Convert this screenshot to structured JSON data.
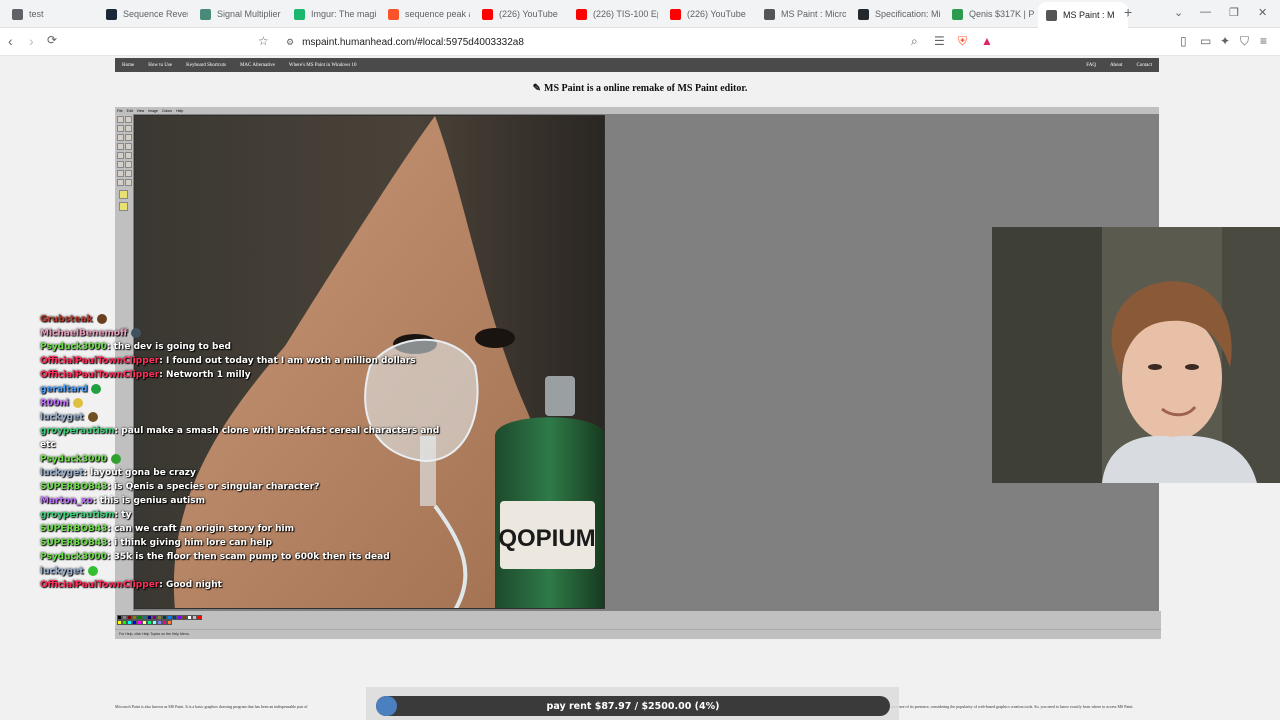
{
  "browser": {
    "tabs": [
      {
        "title": "test",
        "icon": "globe-icon",
        "color": "#5f6368"
      },
      {
        "title": "Sequence Rever",
        "icon": "steam-icon",
        "color": "#1b2838"
      },
      {
        "title": "Signal Multiplier",
        "icon": "signal-icon",
        "color": "#4a8a7a"
      },
      {
        "title": "Imgur: The magi",
        "icon": "imgur-icon",
        "color": "#1bb76e"
      },
      {
        "title": "sequence peak a",
        "icon": "brave-icon",
        "color": "#fb542b"
      },
      {
        "title": "(226) YouTube",
        "icon": "youtube-icon",
        "color": "#ff0000"
      },
      {
        "title": "(226) TIS-100 Ep",
        "icon": "youtube-icon",
        "color": "#ff0000"
      },
      {
        "title": "(226) YouTube",
        "icon": "youtube-icon",
        "color": "#ff0000"
      },
      {
        "title": "MS Paint : Micro",
        "icon": "mspaint-icon",
        "color": "#555555"
      },
      {
        "title": "Specification: Mi",
        "icon": "github-icon",
        "color": "#24292e"
      },
      {
        "title": "Qenis $317K | P",
        "icon": "pill-icon",
        "color": "#2d9b4e"
      },
      {
        "title": "MS Paint : M",
        "icon": "mspaint-icon",
        "color": "#555555",
        "active": true
      }
    ],
    "url": "mspaint.humanhead.com/#local:5975d4003332a8"
  },
  "site": {
    "nav_left": [
      "Home",
      "How to Use",
      "Keyboard Shortcuts",
      "MAC Alternative",
      "Where's MS Paint in Windows 10"
    ],
    "nav_right": [
      "FAQ",
      "About",
      "Contact"
    ],
    "headline": "MS Paint is a online remake of MS Paint editor.",
    "menu": [
      "File",
      "Edit",
      "View",
      "Image",
      "Colors",
      "Help"
    ],
    "status_text": "For Help, click Help Topics on the Help Menu.",
    "article_left": "Microsoft Paint is also known as MS Paint. It is a basic graphics drawing program that has been an indispensable part of",
    "article_right": "unaware of its presence, considering the popularity of web-based graphics creation tools. So, you need to know exactly from where to access MS Paint.",
    "canvas_label": "QOPIUM",
    "palette_colors": [
      "#000000",
      "#808080",
      "#800000",
      "#808000",
      "#008000",
      "#008080",
      "#000080",
      "#800080",
      "#808040",
      "#004040",
      "#0080ff",
      "#004080",
      "#8000ff",
      "#804000",
      "#ffffff",
      "#c0c0c0",
      "#ff0000",
      "#ffff00",
      "#00ff00",
      "#00ffff",
      "#0000ff",
      "#ff00ff",
      "#ffff80",
      "#00ff80",
      "#80ffff",
      "#8080ff",
      "#ff0080",
      "#ff8040"
    ]
  },
  "chat": [
    {
      "user": "Grubsteak",
      "color": "#c0392b",
      "msg": "",
      "emote": "#6a4020"
    },
    {
      "user": "MichaelBenemoff",
      "color": "#e8a0c0",
      "msg": "",
      "emote": "#405060"
    },
    {
      "user": "Psyduck3000",
      "color": "#6ee04a",
      "msg": "the dev is going to bed"
    },
    {
      "user": "OfficialPaulTownClipper",
      "color": "#ff2d5a",
      "msg": "I found out today that I am woth a million dollars"
    },
    {
      "user": "OfficialPaulTownClipper",
      "color": "#ff2d5a",
      "msg": "Networth 1 milly"
    },
    {
      "user": "geraltard",
      "color": "#4aa0ff",
      "msg": "",
      "emote": "#20a040"
    },
    {
      "user": "R00ni",
      "color": "#c070ff",
      "msg": "",
      "emote": "#e0c040"
    },
    {
      "user": "luckyget",
      "color": "#9ab0d0",
      "msg": "",
      "emote": "#705020"
    },
    {
      "user": "groyperautism",
      "color": "#3fd07a",
      "msg": "paul make a smash clone with breakfast cereal characters and"
    },
    {
      "user": "",
      "color": "#9ab0d0",
      "msg": "etc"
    },
    {
      "user": "Psyduck3000",
      "color": "#6ee04a",
      "msg": "",
      "emote": "#30a030"
    },
    {
      "user": "luckyget",
      "color": "#9ab0d0",
      "msg": "layout gona be crazy"
    },
    {
      "user": "SUPERBOB43",
      "color": "#6ee04a",
      "msg": "is Qenis a species or singular character?"
    },
    {
      "user": "Marton_xo",
      "color": "#c070ff",
      "msg": "this is genius autism"
    },
    {
      "user": "groyperautism",
      "color": "#3fd07a",
      "msg": "ty"
    },
    {
      "user": "SUPERBOB43",
      "color": "#6ee04a",
      "msg": "can we craft an origin story for him"
    },
    {
      "user": "SUPERBOB43",
      "color": "#6ee04a",
      "msg": "i think giving him lore can help"
    },
    {
      "user": "Psyduck3000",
      "color": "#6ee04a",
      "msg": "35k is the floor then scam pump to 600k then its dead"
    },
    {
      "user": "luckyget",
      "color": "#9ab0d0",
      "msg": "",
      "emote": "#30c030"
    },
    {
      "user": "OfficialPaulTownClipper",
      "color": "#ff2d5a",
      "msg": "Good night"
    }
  ],
  "rent_goal": {
    "label": "pay rent $87.97 / $2500.00 (4%)",
    "progress_fraction": 0.04,
    "fill_color": "#4a7fc0"
  }
}
